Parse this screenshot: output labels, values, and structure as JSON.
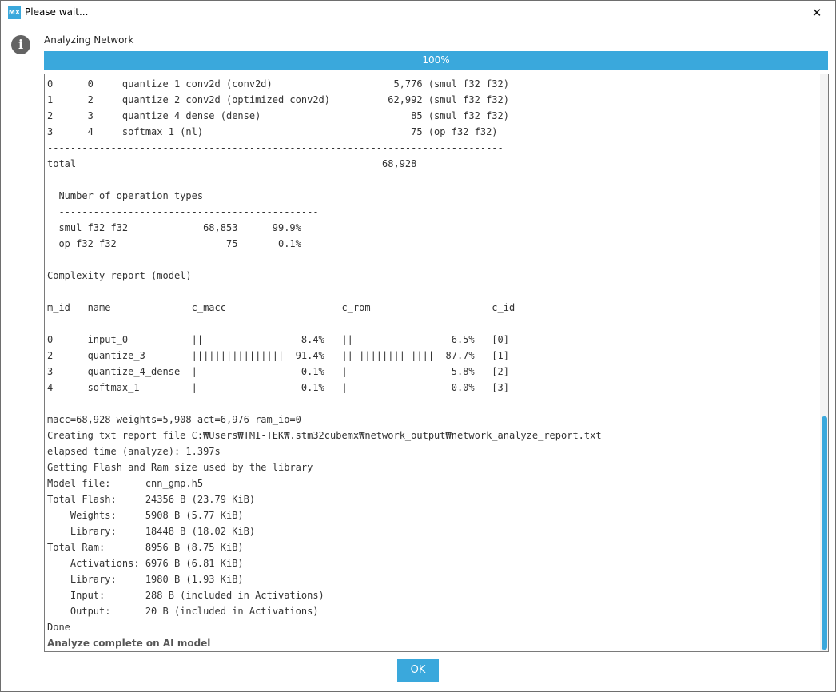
{
  "window": {
    "icon_text": "MX",
    "title": "Please wait...",
    "close_glyph": "✕"
  },
  "status": {
    "icon": "info-icon",
    "heading": "Analyzing Network",
    "progress_percent": 100,
    "progress_label": "100%"
  },
  "log": {
    "scroll_position": 0.72,
    "lines": [
      "0      0     quantize_1_conv2d (conv2d)                     5,776 (smul_f32_f32)",
      "1      2     quantize_2_conv2d (optimized_conv2d)          62,992 (smul_f32_f32)",
      "2      3     quantize_4_dense (dense)                          85 (smul_f32_f32)",
      "3      4     softmax_1 (nl)                                    75 (op_f32_f32)",
      "-------------------------------------------------------------------------------",
      "total                                                     68,928",
      "",
      "  Number of operation types",
      "  ---------------------------------------------",
      "  smul_f32_f32             68,853      99.9%",
      "  op_f32_f32                   75       0.1%",
      "",
      "Complexity report (model)",
      "-----------------------------------------------------------------------------",
      "m_id   name              c_macc                    c_rom                     c_id",
      "-----------------------------------------------------------------------------",
      "0      input_0           ||                 8.4%   ||                 6.5%   [0]",
      "2      quantize_3        ||||||||||||||||  91.4%   ||||||||||||||||  87.7%   [1]",
      "3      quantize_4_dense  |                  0.1%   |                  5.8%   [2]",
      "4      softmax_1         |                  0.1%   |                  0.0%   [3]",
      "-----------------------------------------------------------------------------",
      "macc=68,928 weights=5,908 act=6,976 ram_io=0",
      "Creating txt report file C:₩Users₩TMI-TEK₩.stm32cubemx₩network_output₩network_analyze_report.txt",
      "elapsed time (analyze): 1.397s",
      "Getting Flash and Ram size used by the library",
      "Model file:      cnn_gmp.h5",
      "Total Flash:     24356 B (23.79 KiB)",
      "    Weights:     5908 B (5.77 KiB)",
      "    Library:     18448 B (18.02 KiB)",
      "Total Ram:       8956 B (8.75 KiB)",
      "    Activations: 6976 B (6.81 KiB)",
      "    Library:     1980 B (1.93 KiB)",
      "    Input:       288 B (included in Activations)",
      "    Output:      20 B (included in Activations)",
      "Done"
    ],
    "final_line": "Analyze complete on AI model"
  },
  "actions": {
    "ok_label": "OK"
  },
  "colors": {
    "accent": "#3aa8dc"
  }
}
